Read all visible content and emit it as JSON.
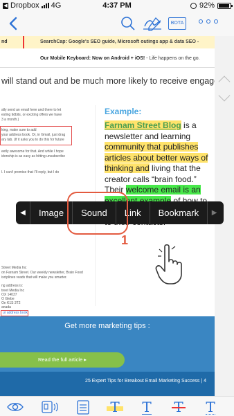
{
  "status": {
    "back_app": "Dropbox",
    "network": "4G",
    "time": "4:37 PM",
    "battery": "92%"
  },
  "toolbar": {
    "bota_label": "BOTA"
  },
  "document": {
    "news_row1_left": "nd",
    "news_row1_right": "SearchCap: Google's SEO guide, Microsoft outings app & data SEO -",
    "news_row2_bold": "Our Mobile Keyboard: Now on Android + iOS!",
    "news_row2_rest": " - Life happens on the go.",
    "big_line": "will stand out and be much more likely to receive engagement.",
    "left_col_lines": [
      "ally send an email here and there to let",
      "esting tidbits, or exciting offers we have",
      "3 a month.)",
      "king, make sure to add",
      "your address book. Or, in Gmail, just drag",
      "ary tab. (If it asks you to do this for future",
      "eetly awesome for that. And while I hope",
      "idonship is as easy as hitting unsubscribe",
      "l. I can't promise that I'll reply, but I do",
      "Street Media Inc",
      "on Farnam Street. Our weekly newsletter, Brain Food",
      "isciplines reads that will make you smarter.",
      "ng address is:",
      "treet Media Inc",
      "OX 14037",
      "O Glebe",
      "On K1S 3T2",
      "anada",
      "ur address book"
    ],
    "example_title": "Example:",
    "example_link": "Farnam Street Blog",
    "example_t1": " is a newsletter and learning ",
    "example_hl1": "community that publishes articles about better ways of thinking and",
    "example_t2": " living that the creator calls “brain food.” Their ",
    "example_hl2": "welcome email is an excellent example",
    "example_t3": " of how to ask readers to add the sender to their contacts.",
    "cta_title": "Get more marketing tips :",
    "cta_button": "Read the full article ▸",
    "footer": "25 Expert Tips for Breakout Email Marketing Success  |  4"
  },
  "context_menu": {
    "items": [
      "Image",
      "Sound",
      "Link",
      "Bookmark"
    ]
  },
  "annotation": {
    "number": "1"
  },
  "colors": {
    "accent": "#2e73d6",
    "highlight_yellow": "#ffe36b",
    "highlight_green": "#48e84a",
    "annotation_red": "#e35a3f"
  }
}
